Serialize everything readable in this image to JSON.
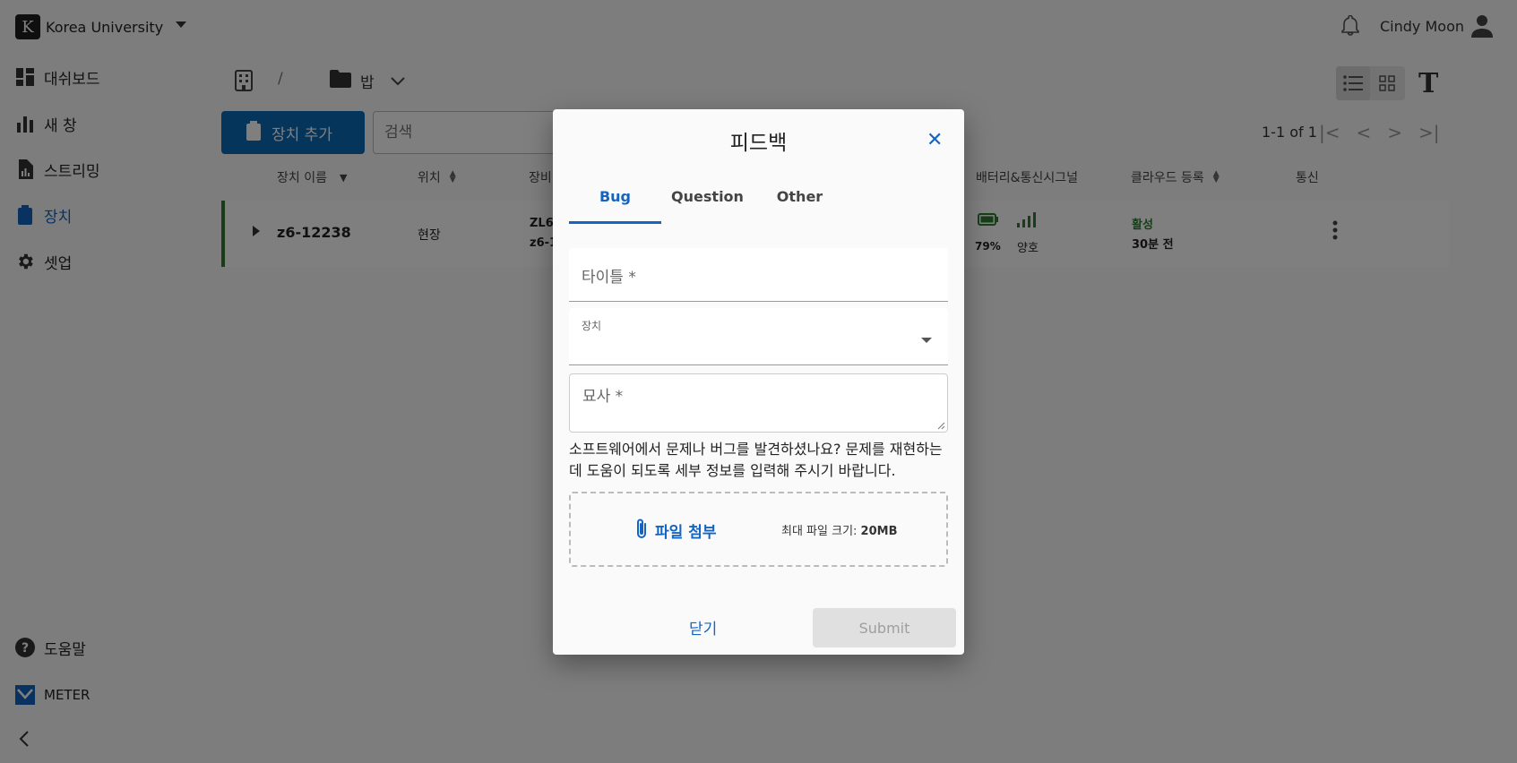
{
  "org": {
    "logo_letter": "K",
    "name": "Korea University"
  },
  "user": {
    "name": "Cindy Moon"
  },
  "nav": {
    "items": [
      {
        "label": "대쉬보드",
        "icon": "dashboard-icon"
      },
      {
        "label": "새 창",
        "icon": "bar-chart-icon"
      },
      {
        "label": "스트리밍",
        "icon": "document-chart-icon"
      },
      {
        "label": "장치",
        "icon": "device-icon",
        "active": true
      },
      {
        "label": "셋업",
        "icon": "gear-icon"
      }
    ],
    "help": "도움말",
    "brand": "METER"
  },
  "toolbar": {
    "breadcrumb_sep": "/",
    "folder": "밥",
    "add_device": "장치 추가",
    "search_placeholder": "검색",
    "pager_text": "1-1 of 1"
  },
  "table": {
    "headers": {
      "name": "장치 이름",
      "location": "위치",
      "device_type": "장비",
      "battery_signal": "배터리&통신시그널",
      "cloud": "클라우드 등록",
      "comm": "통신"
    },
    "row": {
      "name": "z6-12238",
      "location": "현장",
      "model_line1": "ZL6",
      "model_line2": "z6-1",
      "battery": "79%",
      "signal": "양호",
      "cloud_status": "활성",
      "cloud_time": "30분 전"
    }
  },
  "modal": {
    "title": "피드백",
    "tabs": [
      "Bug",
      "Question",
      "Other"
    ],
    "title_field": "타이틀 *",
    "device_label": "장치",
    "description_field": "묘사 *",
    "help_text": "소프트웨어에서 문제나 버그를 발견하셨나요? 문제를 재현하는 데 도움이 되도록 세부 정보를 입력해 주시기 바랍니다.",
    "attach": "파일 첨부",
    "max_size_label": "최대 파일 크기:",
    "max_size_value": "20MB",
    "close": "닫기",
    "submit": "Submit"
  },
  "colors": {
    "accent": "#1565c0",
    "primary_button": "#0d6ab7",
    "active_row": "#2e7d32",
    "battery": "#2e7d32"
  }
}
